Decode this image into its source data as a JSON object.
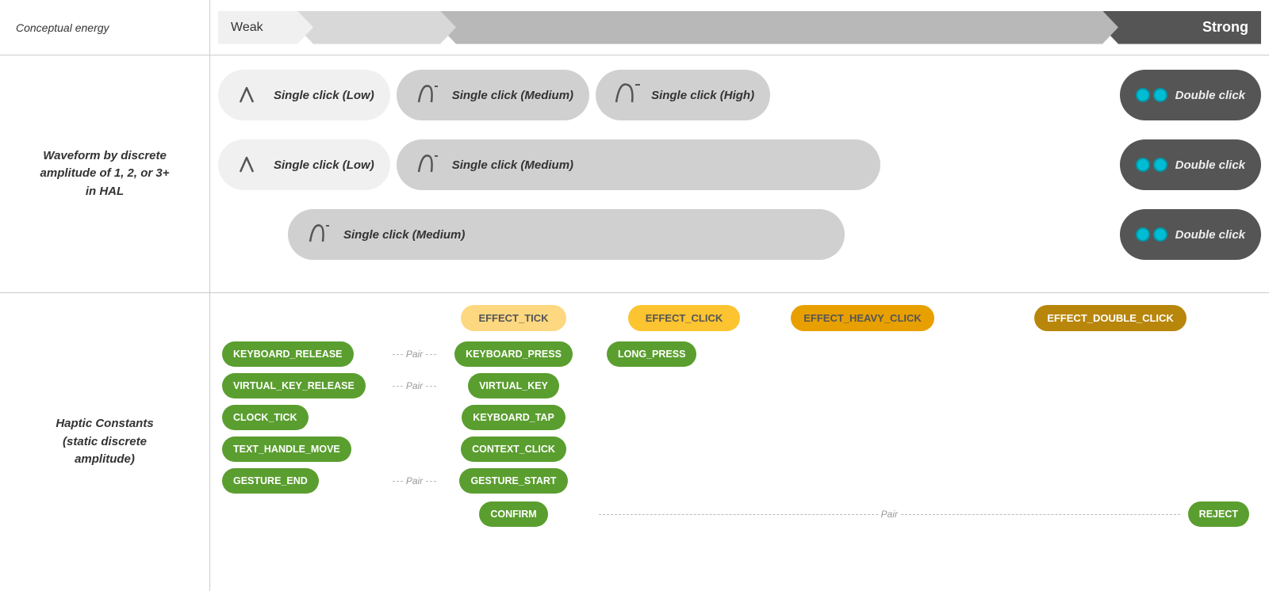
{
  "header": {
    "left_label": "Conceptual energy",
    "weak_label": "Weak",
    "strong_label": "Strong"
  },
  "waveform_section": {
    "label": "Waveform by discrete\namplitude of 1, 2, or 3+\nin HAL",
    "row1": {
      "pill1": {
        "icon": "low-wave",
        "text": "Single click (Low)"
      },
      "pill2": {
        "icon": "medium-wave",
        "text": "Single click (Medium)"
      },
      "pill3": {
        "icon": "high-wave",
        "text": "Single click (High)"
      },
      "pill4": {
        "icon": "double-click",
        "text": "Double click"
      }
    },
    "row2": {
      "pill1": {
        "icon": "low-wave",
        "text": "Single click (Low)"
      },
      "pill2": {
        "icon": "medium-wave",
        "text": "Single click (Medium)"
      },
      "pill4": {
        "icon": "double-click",
        "text": "Double click"
      }
    },
    "row3": {
      "pill2": {
        "icon": "medium-wave",
        "text": "Single click (Medium)"
      },
      "pill4": {
        "icon": "double-click",
        "text": "Double click"
      }
    }
  },
  "haptic_section": {
    "label": "Haptic Constants\n(static discrete\namplitude)",
    "effects": {
      "tick": "EFFECT_TICK",
      "click": "EFFECT_CLICK",
      "heavy_click": "EFFECT_HEAVY_CLICK",
      "double_click": "EFFECT_DOUBLE_CLICK"
    },
    "constants": {
      "col1": [
        {
          "label": "KEYBOARD_RELEASE"
        },
        {
          "label": "VIRTUAL_KEY_RELEASE"
        },
        {
          "label": "CLOCK_TICK"
        },
        {
          "label": "TEXT_HANDLE_MOVE"
        },
        {
          "label": "GESTURE_END"
        }
      ],
      "col2": [
        {
          "label": "KEYBOARD_PRESS"
        },
        {
          "label": "VIRTUAL_KEY"
        },
        {
          "label": "KEYBOARD_TAP"
        },
        {
          "label": "CONTEXT_CLICK"
        },
        {
          "label": "GESTURE_START"
        },
        {
          "label": "CONFIRM"
        }
      ],
      "col3": [
        {
          "label": "LONG_PRESS"
        }
      ],
      "col4": [
        {
          "label": "REJECT"
        }
      ],
      "pairs": [
        {
          "from": "KEYBOARD_RELEASE",
          "to": "KEYBOARD_PRESS"
        },
        {
          "from": "VIRTUAL_KEY_RELEASE",
          "to": "VIRTUAL_KEY"
        },
        {
          "from": "GESTURE_END",
          "to": "GESTURE_START"
        },
        {
          "from": "CONFIRM",
          "to": "REJECT"
        }
      ]
    }
  }
}
